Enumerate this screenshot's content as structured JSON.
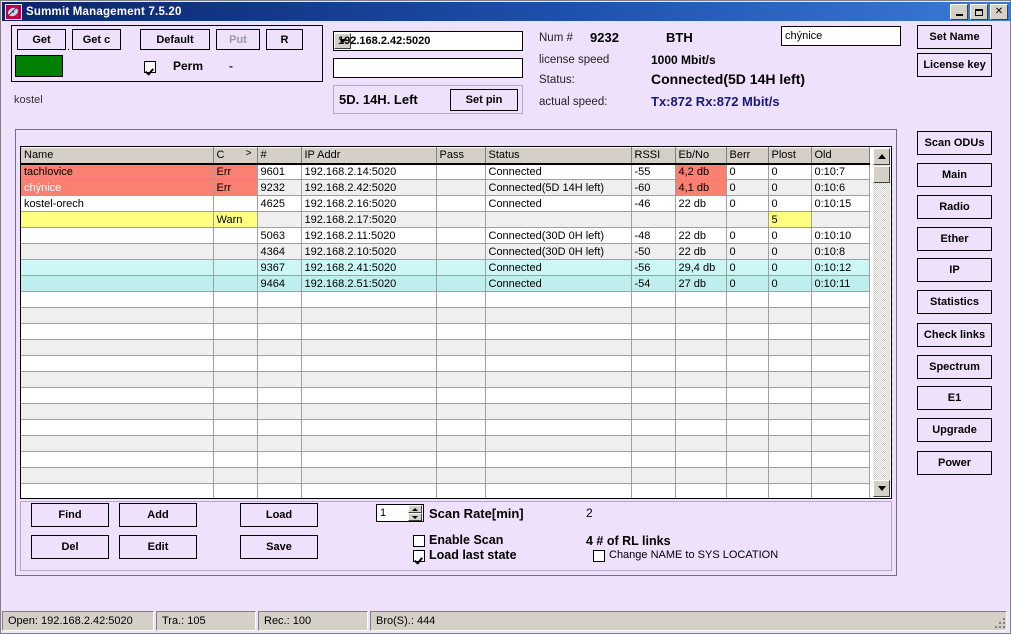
{
  "window": {
    "title": "Summit Management 7.5.20",
    "icon": "satellite-dish-icon",
    "minimize": "minimize-icon",
    "maximize": "maximize-icon",
    "close": "close-icon"
  },
  "toolbar": {
    "get": "Get",
    "get_c": "Get c",
    "separator": ".",
    "default": "Default",
    "put": "Put",
    "r": "R",
    "perm_label": "Perm",
    "perm_checked": true,
    "perm_dash": "-",
    "status_color": "#008000",
    "device_label": "kostel"
  },
  "connection": {
    "ip_combo_value": "192.168.2.42:5020",
    "text_field_value": "",
    "pin_time_label": "5D.  14H. Left",
    "set_pin_button": "Set pin"
  },
  "status": {
    "num_label": "Num #",
    "num_value": "9232",
    "bth": "BTH",
    "license_speed_label": "license speed",
    "license_speed_value": "1000 Mbit/s",
    "status_label": "Status:",
    "status_value": "Connected(5D 14H left)",
    "actual_speed_label": "actual speed:",
    "actual_speed_value": "Tx:872 Rx:872 Mbit/s",
    "actual_speed_color": "#18187a",
    "name_field_value": "chýnice"
  },
  "sidebar": {
    "buttons": [
      {
        "id": "set-name",
        "label": "Set Name"
      },
      {
        "id": "license-key",
        "label": "License key"
      },
      {
        "id": "scan-odus",
        "label": "Scan ODUs"
      },
      {
        "id": "main",
        "label": "Main"
      },
      {
        "id": "radio",
        "label": "Radio"
      },
      {
        "id": "ether",
        "label": "Ether"
      },
      {
        "id": "ip",
        "label": "IP"
      },
      {
        "id": "statistics",
        "label": "Statistics"
      },
      {
        "id": "check-links",
        "label": "Check links"
      },
      {
        "id": "spectrum",
        "label": "Spectrum"
      },
      {
        "id": "e1",
        "label": "E1"
      },
      {
        "id": "upgrade",
        "label": "Upgrade"
      },
      {
        "id": "power",
        "label": "Power"
      }
    ]
  },
  "table": {
    "columns": [
      "Name",
      "C",
      "#",
      "IP Addr",
      "Pass",
      "Status",
      "RSSI",
      "Eb/No",
      "Berr",
      "Plost",
      "Old"
    ],
    "sort_marker": ">",
    "rows": [
      {
        "name": "tachlovice",
        "c": "Err",
        "num": "9601",
        "ip": "192.168.2.14:5020",
        "pass": "",
        "status": "Connected",
        "rssi": "-55",
        "ebno": "4,2 db",
        "berr": "0",
        "plost": "0",
        "old": "0:10:7",
        "row_color": "red",
        "ebno_color": "red",
        "name_text": "dark"
      },
      {
        "name": "chýnice",
        "c": "Err",
        "num": "9232",
        "ip": "192.168.2.42:5020",
        "pass": "",
        "status": "Connected(5D 14H left)",
        "rssi": "-60",
        "ebno": "4,1 db",
        "berr": "0",
        "plost": "0",
        "old": "0:10:6",
        "row_color": "red",
        "ebno_color": "red",
        "name_text": "white"
      },
      {
        "name": "kostel-orech",
        "c": "",
        "num": "4625",
        "ip": "192.168.2.16:5020",
        "pass": "",
        "status": "Connected",
        "rssi": "-46",
        "ebno": "22 db",
        "berr": "0",
        "plost": "0",
        "old": "0:10:15",
        "row_color": "none",
        "ebno_color": "none",
        "name_text": "dark"
      },
      {
        "name": "",
        "c": "Warn",
        "num": "",
        "ip": "192.168.2.17:5020",
        "pass": "",
        "status": "",
        "rssi": "",
        "ebno": "",
        "berr": "",
        "plost": "5",
        "old": "",
        "row_color": "warn",
        "ebno_color": "none",
        "name_text": "dark"
      },
      {
        "name": "",
        "c": "",
        "num": "5063",
        "ip": "192.168.2.11:5020",
        "pass": "",
        "status": "Connected(30D 0H left)",
        "rssi": "-48",
        "ebno": "22 db",
        "berr": "0",
        "plost": "0",
        "old": "0:10:10",
        "row_color": "none",
        "ebno_color": "none",
        "name_text": "dark"
      },
      {
        "name": "",
        "c": "",
        "num": "4364",
        "ip": "192.168.2.10:5020",
        "pass": "",
        "status": "Connected(30D 0H left)",
        "rssi": "-50",
        "ebno": "22 db",
        "berr": "0",
        "plost": "0",
        "old": "0:10:8",
        "row_color": "none",
        "ebno_color": "none",
        "name_text": "dark"
      },
      {
        "name": "",
        "c": "",
        "num": "9367",
        "ip": "192.168.2.41:5020",
        "pass": "",
        "status": "Connected",
        "rssi": "-56",
        "ebno": "29,4 db",
        "berr": "0",
        "plost": "0",
        "old": "0:10:12",
        "row_color": "cyan",
        "ebno_color": "none",
        "name_text": "dark"
      },
      {
        "name": "",
        "c": "",
        "num": "9464",
        "ip": "192.168.2.51:5020",
        "pass": "",
        "status": "Connected",
        "rssi": "-54",
        "ebno": "27 db",
        "berr": "0",
        "plost": "0",
        "old": "0:10:11",
        "row_color": "cyan2",
        "ebno_color": "none",
        "name_text": "dark"
      }
    ],
    "empty_row_count": 13,
    "scroll_up_icon": "arrow-up-icon",
    "scroll_down_icon": "arrow-down-icon"
  },
  "bottom": {
    "find": "Find",
    "del": "Del",
    "add": "Add",
    "edit": "Edit",
    "load": "Load",
    "save": "Save",
    "scan_rate_value": "1",
    "scan_rate_label": "Scan Rate[min]",
    "enable_scan_label": "Enable Scan",
    "enable_scan_checked": false,
    "load_last_state_label": "Load last state",
    "load_last_state_checked": true,
    "counter_value": "2",
    "rl_links_label": "4 # of RL links",
    "change_name_label": "Change NAME to  SYS LOCATION",
    "change_name_checked": false
  },
  "statusbar": {
    "open": "Open: 192.168.2.42:5020",
    "tra": "Tra.: 105",
    "rec": "Rec.: 100",
    "bro": "Bro(S).: 444"
  }
}
